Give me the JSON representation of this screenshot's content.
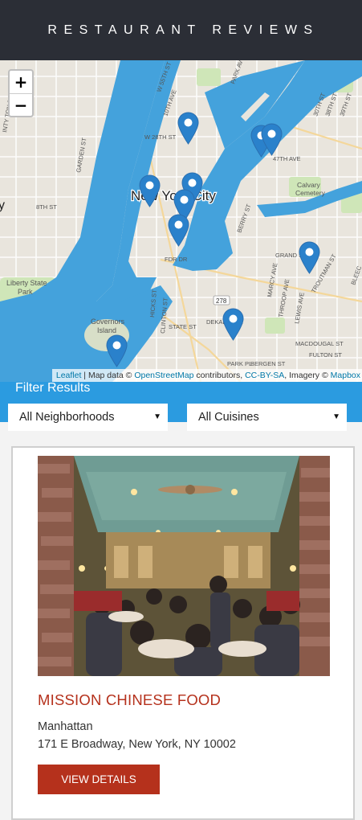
{
  "header": {
    "title": "RESTAURANT REVIEWS"
  },
  "map": {
    "city_label": "New York City",
    "zoom_in": "+",
    "zoom_out": "−",
    "marker_color": "#2a81cb",
    "water_color": "#44a2dc",
    "park_color": "#cfe6b8",
    "street_labels": [
      "W 55TH ST",
      "10TH AVE",
      "W 28TH ST",
      "PARK AV",
      "8TH ST",
      "GARDEN ST",
      "47TH AVE",
      "Calvary Cemetery",
      "39TH ST",
      "BERRY ST",
      "FDR DR",
      "GRAND ST",
      "Liberty State Park",
      "Governors Island",
      "HICKS ST",
      "CLINTON ST",
      "STATE ST",
      "DEKALB AVE",
      "278",
      "MARCY AVE",
      "THROOP AVE",
      "LEWIS AVE",
      "MACDOUGAL ST",
      "FULTON ST",
      "BERGEN ST",
      "PARK PL",
      "TROUTMAN ST",
      "BLEEC",
      "PARK AVE"
    ],
    "attribution": {
      "leaflet": "Leaflet",
      "map_data": " | Map data © ",
      "osm": "OpenStreetMap",
      "contributors": " contributors, ",
      "license": "CC-BY-SA",
      "imagery": ", Imagery © ",
      "mapbox": "Mapbox"
    }
  },
  "filter": {
    "title": "Filter Results",
    "neighborhoods_selected": "All Neighborhoods",
    "cuisines_selected": "All Cuisines",
    "caret": "▼"
  },
  "restaurants": [
    {
      "name": "MISSION CHINESE FOOD",
      "neighborhood": "Manhattan",
      "address": "171 E Broadway, New York, NY 10002",
      "button_label": "VIEW DETAILS"
    }
  ],
  "colors": {
    "header_bg": "#2b2e36",
    "filter_bg": "#2b9be0",
    "accent": "#b5311c"
  }
}
